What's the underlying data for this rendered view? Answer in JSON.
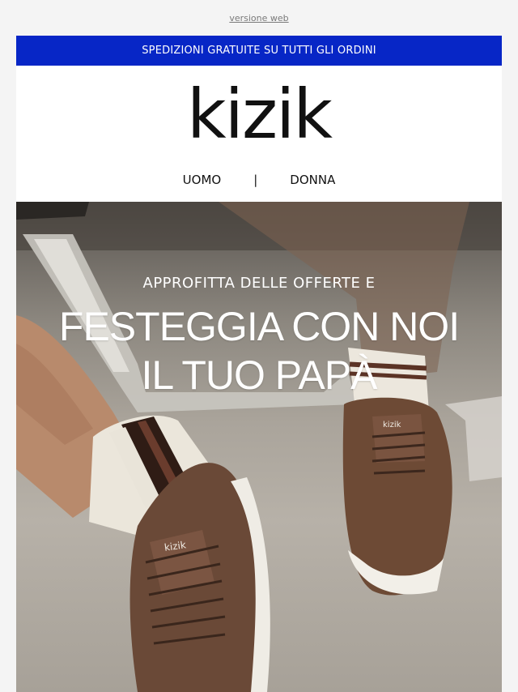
{
  "top": {
    "web_version_link": "versione web"
  },
  "banner": {
    "text": "SPEDIZIONI GRATUITE SU TUTTI GLI ORDINI",
    "color": "#0726c6"
  },
  "brand": {
    "logo_text": "kizik"
  },
  "nav": {
    "items": [
      {
        "label": "UOMO"
      },
      {
        "label": "DONNA"
      }
    ],
    "separator": "|"
  },
  "hero": {
    "kicker": "APPROFITTA DELLE OFFERTE E",
    "title_line1": "FESTEGGIA CON NOI",
    "title_line2": "IL TUO PAPÀ",
    "shoe_logo": "kizik"
  }
}
